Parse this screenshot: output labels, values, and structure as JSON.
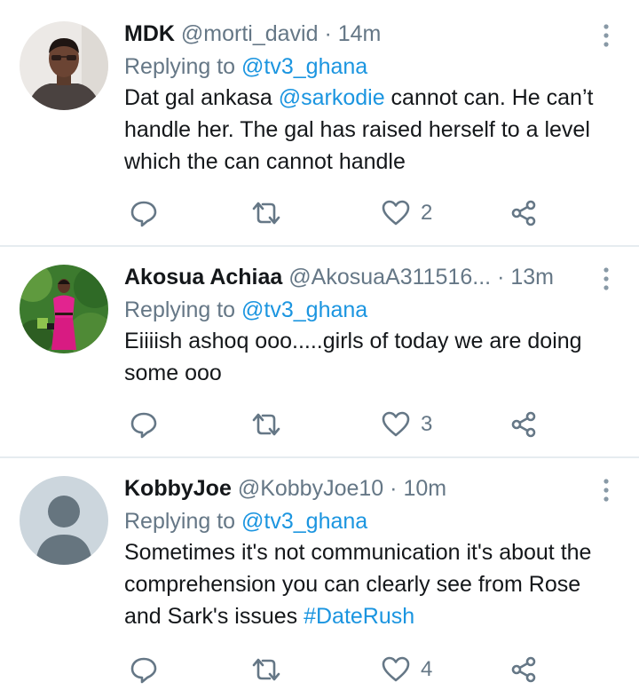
{
  "tweets": [
    {
      "name": "MDK",
      "handle": "@morti_david",
      "dot": "·",
      "time": "14m",
      "replying_prefix": "Replying to ",
      "replying_handle": "@tv3_ghana",
      "text_parts": [
        "Dat gal ankasa ",
        "@sarkodie",
        " cannot can. He can’t handle her. The gal has raised herself to a level which the can cannot handle"
      ],
      "like_count": "2"
    },
    {
      "name": "Akosua Achiaa",
      "handle": "@AkosuaA311516...",
      "dot": "·",
      "time": "13m",
      "replying_prefix": "Replying to ",
      "replying_handle": "@tv3_ghana",
      "text": "Eiiiish ashoq ooo.....girls of today we are doing some ooo",
      "like_count": "3"
    },
    {
      "name": "KobbyJoe",
      "handle": "@KobbyJoe10",
      "dot": "·",
      "time": "10m",
      "replying_prefix": "Replying to ",
      "replying_handle": "@tv3_ghana",
      "text_parts": [
        "Sometimes it's not communication it's about the comprehension you can clearly see from Rose and Sark's issues ",
        "#DateRush"
      ],
      "like_count": "4"
    }
  ],
  "icons": {
    "reply": "reply-icon",
    "retweet": "retweet-icon",
    "like": "heart-icon",
    "share": "share-icon",
    "more": "more-vertical-icon"
  },
  "colors": {
    "link": "#1b95e0",
    "secondary_text": "#657786",
    "divider": "#e6ecf0"
  }
}
